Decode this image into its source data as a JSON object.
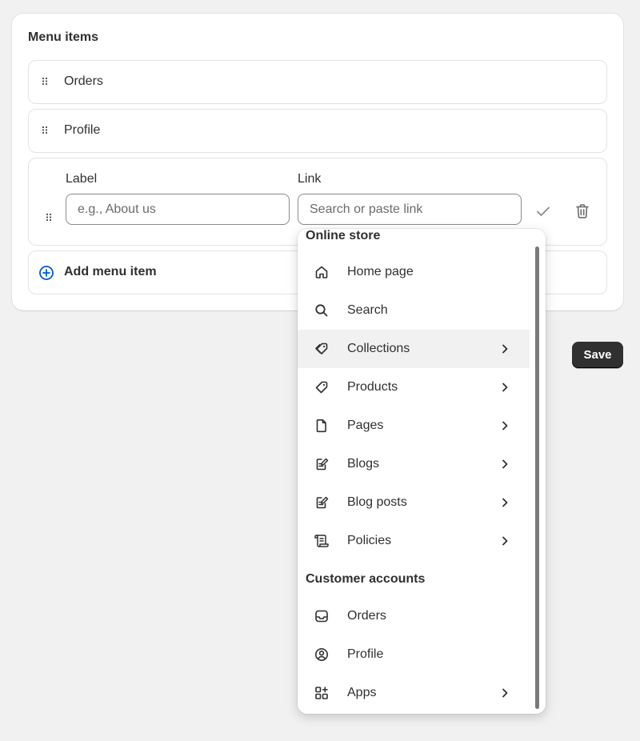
{
  "card": {
    "title": "Menu items",
    "items": [
      {
        "label": "Orders"
      },
      {
        "label": "Profile"
      }
    ],
    "edit_row": {
      "label_title": "Label",
      "label_placeholder": "e.g., About us",
      "link_title": "Link",
      "link_placeholder": "Search or paste link"
    },
    "add_label": "Add menu item"
  },
  "save_label": "Save",
  "dropdown": {
    "online_store_title": "Online store",
    "online_store_items": [
      {
        "label": "Home page",
        "icon": "home-icon",
        "has_submenu": false
      },
      {
        "label": "Search",
        "icon": "search-icon",
        "has_submenu": false
      },
      {
        "label": "Collections",
        "icon": "collections-icon",
        "has_submenu": true
      },
      {
        "label": "Products",
        "icon": "tag-icon",
        "has_submenu": true
      },
      {
        "label": "Pages",
        "icon": "page-icon",
        "has_submenu": true
      },
      {
        "label": "Blogs",
        "icon": "blog-icon",
        "has_submenu": true
      },
      {
        "label": "Blog posts",
        "icon": "blog-post-icon",
        "has_submenu": true
      },
      {
        "label": "Policies",
        "icon": "policies-icon",
        "has_submenu": true
      }
    ],
    "customer_accounts_title": "Customer accounts",
    "customer_accounts_items": [
      {
        "label": "Orders",
        "icon": "inbox-icon",
        "has_submenu": false
      },
      {
        "label": "Profile",
        "icon": "profile-icon",
        "has_submenu": false
      },
      {
        "label": "Apps",
        "icon": "apps-icon",
        "has_submenu": true
      }
    ]
  },
  "colors": {
    "accent_blue": "#005bd3",
    "save_button_bg": "#303030",
    "page_bg": "#f1f1f1"
  }
}
